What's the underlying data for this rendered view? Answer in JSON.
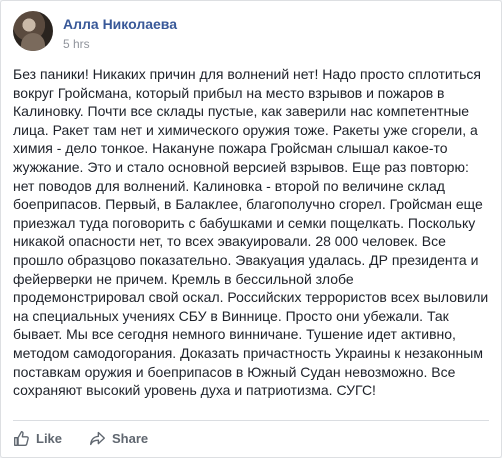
{
  "post": {
    "author": "Алла Николаева",
    "time": "5 hrs",
    "text": "Без паники! Никаких причин для волнений нет! Надо просто сплотиться\nвокруг Гройсмана, который прибыл на место взрывов и пожаров в\nКалиновку. Почти все склады пустые, как заверили нас компетентные\nлица. Ракет там нет и химического оружия тоже. Ракеты уже сгорели, а\nхимия - дело тонкое. Накануне пожара Гройсман слышал какое-то\nжужжание. Это и стало основной версией взрывов. Еще раз повторю:\nнет поводов для волнений. Калиновка - второй по величине склад\nбоеприпасов. Первый, в Балаклее, благополучно сгорел. Гройсман еще\nприезжал туда поговорить с бабушками и семки пощелкать. Поскольку\nникакой опасности нет, то всех эвакуировали. 28 000 человек. Все\nпрошло образцово показательно. Эвакуация удалась. ДР президента и\nфейерверки не причем. Кремль в бессильной злобе\nпродемонстрировал свой оскал. Российских террористов всех выловили\nна специальных учениях СБУ в Виннице. Просто они убежали. Так\nбывает. Мы все сегодня немного винничане. Тушение идет активно,\nметодом самодогорания. Доказать причастность Украины к незаконным\nпоставкам оружия и боеприпасов в Южный Судан невозможно. Все\nсохраняют высокий уровень духа и патриотизма. СУГС!"
  },
  "actions": {
    "like_label": "Like",
    "share_label": "Share"
  },
  "icons": {
    "like": "thumbs-up-icon",
    "share": "share-arrow-icon"
  },
  "colors": {
    "author_link": "#385898",
    "text": "#1d2129",
    "muted": "#606770"
  }
}
